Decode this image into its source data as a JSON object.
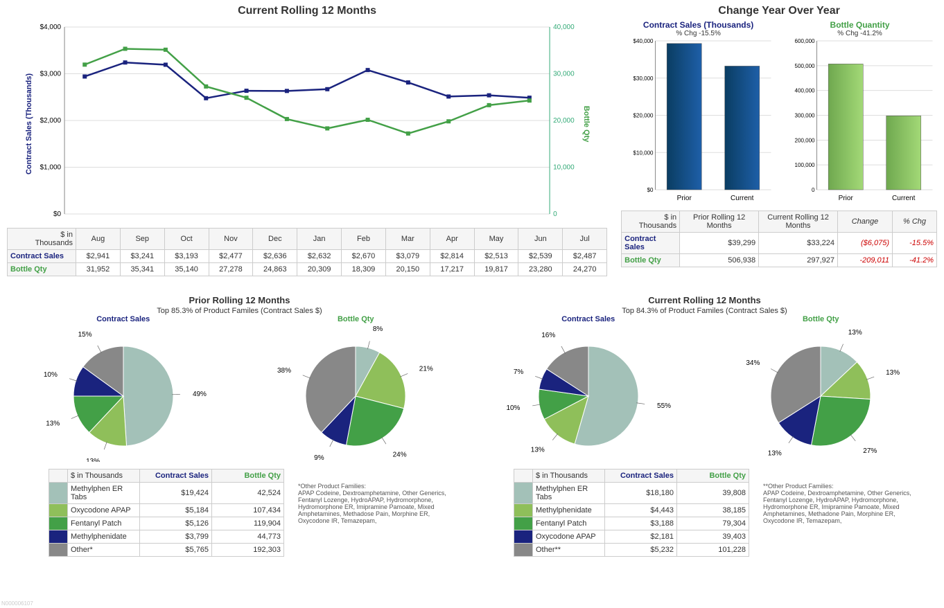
{
  "rolling12": {
    "title": "Current Rolling 12 Months",
    "unitNote": "$ in\nThousands",
    "months": [
      "Aug",
      "Sep",
      "Oct",
      "Nov",
      "Dec",
      "Jan",
      "Feb",
      "Mar",
      "Apr",
      "May",
      "Jun",
      "Jul"
    ],
    "contractLabel": "Contract Sales",
    "bottleLabel": "Bottle Qty",
    "contract": [
      "$2,941",
      "$3,241",
      "$3,193",
      "$2,477",
      "$2,636",
      "$2,632",
      "$2,670",
      "$3,079",
      "$2,814",
      "$2,513",
      "$2,539",
      "$2,487"
    ],
    "bottle": [
      "31,952",
      "35,341",
      "35,140",
      "27,278",
      "24,863",
      "20,309",
      "18,309",
      "20,150",
      "17,217",
      "19,817",
      "23,280",
      "24,270"
    ],
    "leftAxisTitle": "Contract Sales (Thousands)",
    "rightAxisTitle": "Bottle Qty",
    "leftTicks": [
      "$0",
      "$1,000",
      "$2,000",
      "$3,000",
      "$4,000"
    ],
    "rightTicks": [
      "0",
      "10,000",
      "20,000",
      "30,000",
      "40,000"
    ]
  },
  "chart_data": [
    {
      "type": "line",
      "title": "Current Rolling 12 Months",
      "categories": [
        "Aug",
        "Sep",
        "Oct",
        "Nov",
        "Dec",
        "Jan",
        "Feb",
        "Mar",
        "Apr",
        "May",
        "Jun",
        "Jul"
      ],
      "series": [
        {
          "name": "Contract Sales (Thousands)",
          "axis": "left",
          "values": [
            2941,
            3241,
            3193,
            2477,
            2636,
            2632,
            2670,
            3079,
            2814,
            2513,
            2539,
            2487
          ]
        },
        {
          "name": "Bottle Qty",
          "axis": "right",
          "values": [
            31952,
            35341,
            35140,
            27278,
            24863,
            20309,
            18309,
            20150,
            17217,
            19817,
            23280,
            24270
          ]
        }
      ],
      "ylim_left": [
        0,
        4000
      ],
      "ylim_right": [
        0,
        40000
      ],
      "xlabel": "",
      "ylabel_left": "Contract Sales (Thousands)",
      "ylabel_right": "Bottle Qty"
    },
    {
      "type": "bar",
      "title": "Change Year Over Year — Contract Sales (Thousands)",
      "subtitle": "% Chg -15.5%",
      "categories": [
        "Prior",
        "Current"
      ],
      "values": [
        39299,
        33224
      ],
      "ylim": [
        0,
        40000
      ]
    },
    {
      "type": "bar",
      "title": "Change Year Over Year — Bottle Quantity",
      "subtitle": "% Chg -41.2%",
      "categories": [
        "Prior",
        "Current"
      ],
      "values": [
        506938,
        297927
      ],
      "ylim": [
        0,
        600000
      ]
    },
    {
      "type": "pie",
      "title": "Prior Rolling 12 Months — Contract Sales",
      "subtitle": "Top 85.3% of Product Familes (Contract Sales $)",
      "series": [
        {
          "name": "Methylphen ER Tabs",
          "value": 49
        },
        {
          "name": "Oxycodone APAP",
          "value": 13
        },
        {
          "name": "Fentanyl Patch",
          "value": 13
        },
        {
          "name": "Methylphenidate",
          "value": 10
        },
        {
          "name": "Other*",
          "value": 15
        }
      ]
    },
    {
      "type": "pie",
      "title": "Prior Rolling 12 Months — Bottle Qty",
      "series": [
        {
          "name": "Methylphen ER Tabs",
          "value": 8
        },
        {
          "name": "Oxycodone APAP",
          "value": 21
        },
        {
          "name": "Fentanyl Patch",
          "value": 24
        },
        {
          "name": "Methylphenidate",
          "value": 9
        },
        {
          "name": "Other*",
          "value": 38
        }
      ]
    },
    {
      "type": "pie",
      "title": "Current Rolling 12 Months — Contract Sales",
      "subtitle": "Top 84.3% of Product Familes (Contract Sales $)",
      "series": [
        {
          "name": "Methylphen ER Tabs",
          "value": 55
        },
        {
          "name": "Methylphenidate",
          "value": 13
        },
        {
          "name": "Fentanyl Patch",
          "value": 10
        },
        {
          "name": "Oxycodone APAP",
          "value": 7
        },
        {
          "name": "Other**",
          "value": 16
        }
      ]
    },
    {
      "type": "pie",
      "title": "Current Rolling 12 Months — Bottle Qty",
      "series": [
        {
          "name": "Methylphen ER Tabs",
          "value": 13
        },
        {
          "name": "Methylphenidate",
          "value": 13
        },
        {
          "name": "Fentanyl Patch",
          "value": 27
        },
        {
          "name": "Oxycodone APAP",
          "value": 13
        },
        {
          "name": "Other**",
          "value": 34
        }
      ]
    }
  ],
  "yoy": {
    "title": "Change Year Over Year",
    "cs": {
      "title": "Contract Sales (Thousands)",
      "sub": "% Chg -15.5%",
      "ticks": [
        "$0",
        "$10,000",
        "$20,000",
        "$30,000",
        "$40,000"
      ],
      "cats": [
        "Prior",
        "Current"
      ]
    },
    "bq": {
      "title": "Bottle Quantity",
      "sub": "% Chg -41.2%",
      "ticks": [
        "0",
        "100,000",
        "200,000",
        "300,000",
        "400,000",
        "500,000",
        "600,000"
      ],
      "cats": [
        "Prior",
        "Current"
      ]
    },
    "table": {
      "unitNote": "$ in\nThousands",
      "headers": [
        "Prior Rolling 12 Months",
        "Current Rolling 12 Months",
        "Change",
        "% Chg"
      ],
      "rows": [
        {
          "label": "Contract Sales",
          "prior": "$39,299",
          "current": "$33,224",
          "change": "($6,075)",
          "pct": "-15.5%"
        },
        {
          "label": "Bottle Qty",
          "prior": "506,938",
          "current": "297,927",
          "change": "-209,011",
          "pct": "-41.2%"
        }
      ]
    }
  },
  "prior": {
    "title": "Prior Rolling 12 Months",
    "sub": "Top 85.3% of Product Familes (Contract Sales $)",
    "csTitle": "Contract Sales",
    "bqTitle": "Bottle Qty",
    "tableHeader": "$ in Thousands",
    "products": [
      {
        "sw": "#a3c1b8",
        "name": "Methylphen ER Tabs",
        "cs": "$19,424",
        "bq": "42,524"
      },
      {
        "sw": "#8fbf5a",
        "name": "Oxycodone APAP",
        "cs": "$5,184",
        "bq": "107,434"
      },
      {
        "sw": "#43a047",
        "name": "Fentanyl Patch",
        "cs": "$5,126",
        "bq": "119,904"
      },
      {
        "sw": "#1a237e",
        "name": "Methylphenidate",
        "cs": "$3,799",
        "bq": "44,773"
      },
      {
        "sw": "#888",
        "name": "Other*",
        "cs": "$5,765",
        "bq": "192,303"
      }
    ],
    "footnote": "*Other Product Families:\nAPAP Codeine, Dextroamphetamine, Other Generics, Fentanyl Lozenge, HydroAPAP, Hydromorphone, Hydromorphone ER, Imipramine Pamoate, Mixed Amphetamines, Methadose Pain, Morphine ER, Oxycodone IR, Temazepam,"
  },
  "current": {
    "title": "Current Rolling 12 Months",
    "sub": "Top 84.3% of Product Familes (Contract Sales $)",
    "csTitle": "Contract Sales",
    "bqTitle": "Bottle Qty",
    "tableHeader": "$ in Thousands",
    "products": [
      {
        "sw": "#a3c1b8",
        "name": "Methylphen ER Tabs",
        "cs": "$18,180",
        "bq": "39,808"
      },
      {
        "sw": "#8fbf5a",
        "name": "Methylphenidate",
        "cs": "$4,443",
        "bq": "38,185"
      },
      {
        "sw": "#43a047",
        "name": "Fentanyl Patch",
        "cs": "$3,188",
        "bq": "79,304"
      },
      {
        "sw": "#1a237e",
        "name": "Oxycodone APAP",
        "cs": "$2,181",
        "bq": "39,403"
      },
      {
        "sw": "#888",
        "name": "Other**",
        "cs": "$5,232",
        "bq": "101,228"
      }
    ],
    "footnote": "**Other Product Families:\nAPAP Codeine, Dextroamphetamine, Other Generics, Fentanyl Lozenge, HydroAPAP, Hydromorphone, Hydromorphone ER, Imipramine Pamoate, Mixed Amphetamines, Methadone Pain, Morphine ER, Oxycodone IR, Temazepam,"
  },
  "idTag": "N000006107"
}
